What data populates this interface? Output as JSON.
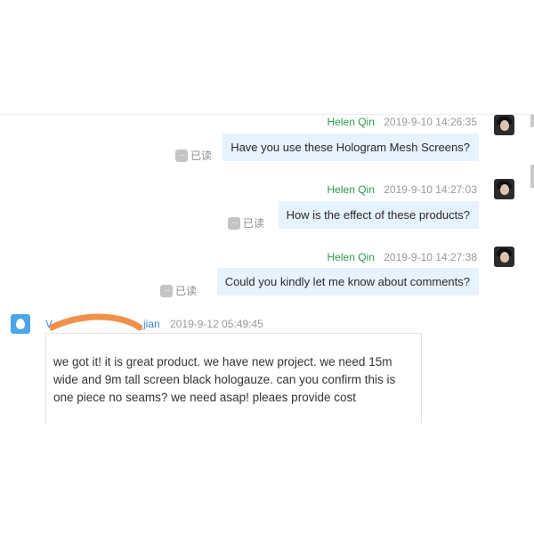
{
  "chat": {
    "messages_out": [
      {
        "sender": "Helen Qin",
        "time": "2019-9-10 14:26:35",
        "text": "Have you use these Hologram Mesh Screens?",
        "read_label": "已读"
      },
      {
        "sender": "Helen Qin",
        "time": "2019-9-10 14:27:03",
        "text": "How is the effect of these products?",
        "read_label": "已读"
      },
      {
        "sender": "Helen Qin",
        "time": "2019-9-10 14:27:38",
        "text": "Could you kindly let me know about comments?",
        "read_label": "已读"
      }
    ],
    "message_in": {
      "sender_visible": "V",
      "sender_tail": "jian",
      "time": "2019-9-12 05:49:45",
      "text": "we got it! it is great product.  we have new project.  we need 15m wide and 9m tall screen black hologauze.  can you confirm this is one piece no seams?  we need asap!  pleaes provide cost"
    },
    "icons": {
      "read_status": "ellipsis-badge-icon",
      "outgoing_avatar": "user-photo-avatar",
      "incoming_avatar": "water-drop-icon"
    },
    "colors": {
      "sender_out": "#2e9a4a",
      "sender_in": "#3a8ccf",
      "bubble_out": "#e7f2ff",
      "redaction": "#f0914a"
    }
  }
}
